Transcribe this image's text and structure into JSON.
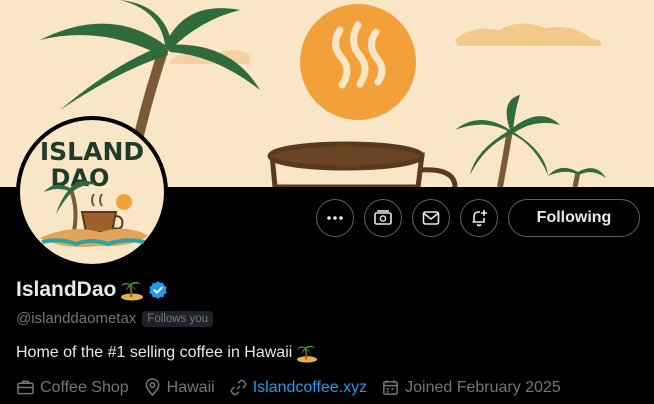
{
  "profile": {
    "display_name": "IslandDao",
    "handle": "@islanddaometax",
    "follows_you": "Follows you",
    "verified": true,
    "bio": "Home of the #1 selling coffee in Hawaii",
    "avatar_text": "ISLAND DAO"
  },
  "actions": {
    "more_icon": "more-icon",
    "subscribe_icon": "subscribe-icon",
    "message_icon": "mail-icon",
    "notify_icon": "notification-add-icon",
    "following_label": "Following"
  },
  "meta": {
    "category": "Coffee Shop",
    "location": "Hawaii",
    "website": "Islandcoffee.xyz",
    "joined": "Joined February 2025"
  },
  "colors": {
    "accent": "#1d9bf0",
    "muted": "#71767b",
    "border": "#536471",
    "text": "#e7e9ea",
    "banner_bg": "#f8e6c6",
    "sun": "#f2a03a"
  }
}
